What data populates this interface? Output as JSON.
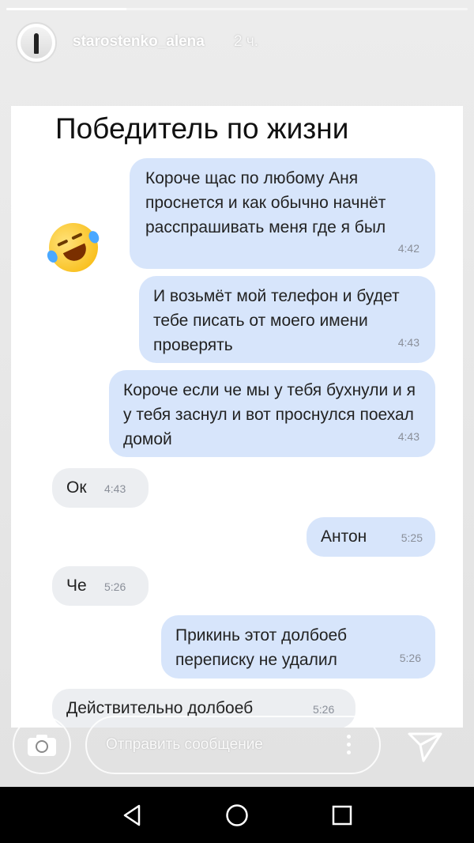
{
  "story": {
    "progress_fraction": 0.26,
    "username": "starostenko_alena",
    "time_ago": "2 ч."
  },
  "screenshot": {
    "title": "Победитель по жизни",
    "messages": [
      {
        "side": "out",
        "text": "Короче щас по любому Аня проснется и как обычно начнёт расспрашивать меня где я был",
        "time": "4:42"
      },
      {
        "side": "out",
        "text": "И возьмёт мой телефон и будет тебе писать от моего имени проверять",
        "time": "4:43"
      },
      {
        "side": "out",
        "text": "Короче если че мы у тебя бухнули и я у тебя заснул и вот проснулся поехал домой",
        "time": "4:43"
      },
      {
        "side": "in",
        "text": "Ок",
        "time": "4:43"
      },
      {
        "side": "out",
        "text": "Антон",
        "time": "5:25"
      },
      {
        "side": "in",
        "text": "Че",
        "time": "5:26"
      },
      {
        "side": "out",
        "text": "Прикинь этот долбоеб переписку не удалил",
        "time": "5:26"
      },
      {
        "side": "in",
        "text": "Действительно долбоеб",
        "time": "5:26"
      }
    ],
    "emoji": "rolling-on-floor-laughing"
  },
  "reply": {
    "placeholder": "Отправить сообщение"
  },
  "colors": {
    "outgoing_bubble": "#d7e5fb",
    "incoming_bubble": "#eceef1"
  }
}
